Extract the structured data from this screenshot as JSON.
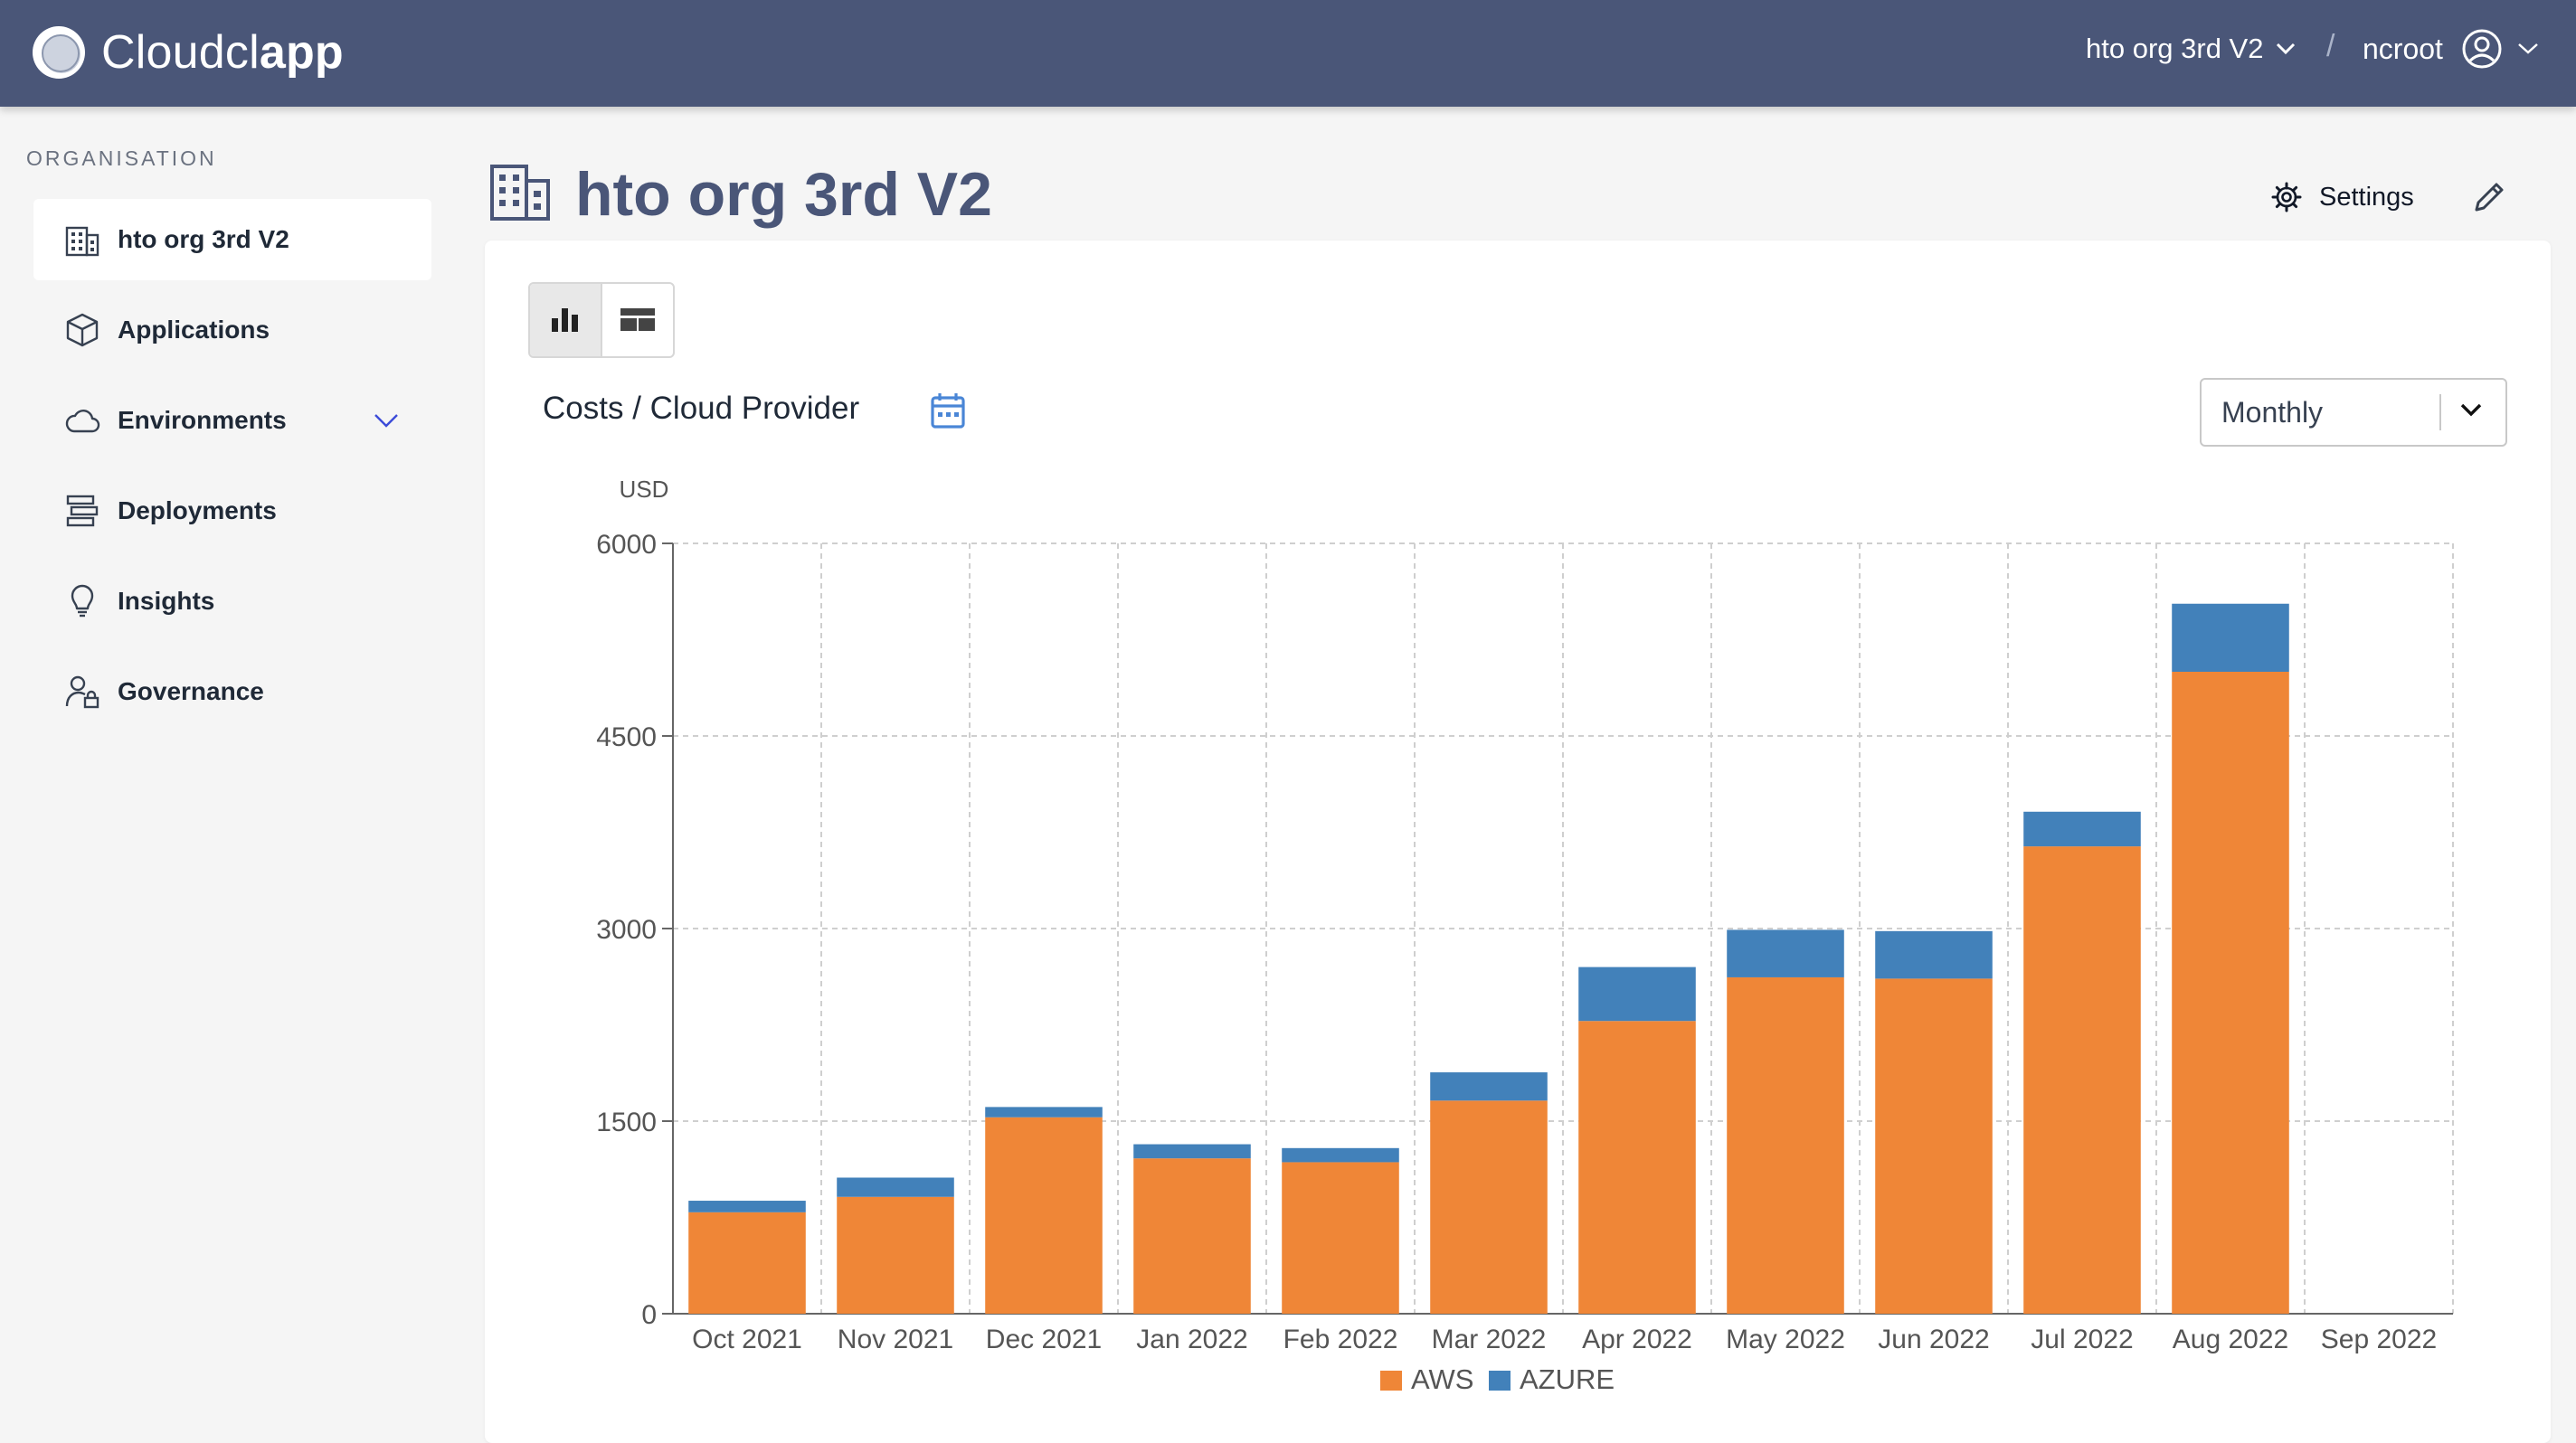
{
  "navbar": {
    "brand_light": "Cloudcl",
    "brand_bold": "app",
    "org_switch_label": "hto org 3rd V2",
    "separator": "/",
    "user_name": "ncroot"
  },
  "sidebar": {
    "title": "ORGANISATION",
    "items": [
      {
        "label": "hto org 3rd V2",
        "icon": "building-icon",
        "active": true
      },
      {
        "label": "Applications",
        "icon": "cube-icon"
      },
      {
        "label": "Environments",
        "icon": "cloud-icon",
        "expandable": true
      },
      {
        "label": "Deployments",
        "icon": "deployments-icon"
      },
      {
        "label": "Insights",
        "icon": "lightbulb-icon"
      },
      {
        "label": "Governance",
        "icon": "user-lock-icon"
      }
    ]
  },
  "header": {
    "title": "hto org 3rd V2",
    "settings_label": "Settings"
  },
  "card": {
    "view_toggle": [
      "bar-chart-view",
      "table-view"
    ],
    "chart_title": "Costs / Cloud Provider",
    "period_select": {
      "value": "Monthly"
    }
  },
  "colors": {
    "navbar": "#4a5678",
    "title": "#4a5678",
    "aws": "#ef8637",
    "azure": "#4281ba",
    "calendar": "#4a86d6"
  },
  "chart_data": {
    "type": "bar",
    "stacked": true,
    "ylabel": "USD",
    "ylim": [
      0,
      6000
    ],
    "yticks": [
      0,
      1500,
      3000,
      4500,
      6000
    ],
    "grid": true,
    "legend": "bottom",
    "categories": [
      "Oct 2021",
      "Nov 2021",
      "Dec 2021",
      "Jan 2022",
      "Feb 2022",
      "Mar 2022",
      "Apr 2022",
      "May 2022",
      "Jun 2022",
      "Jul 2022",
      "Aug 2022",
      "Sep 2022"
    ],
    "series": [
      {
        "name": "AWS",
        "color": "#ef8637",
        "values": [
          790,
          910,
          1530,
          1210,
          1180,
          1660,
          2280,
          2620,
          2610,
          3640,
          5000,
          0
        ]
      },
      {
        "name": "AZURE",
        "color": "#4281ba",
        "values": [
          90,
          150,
          80,
          110,
          110,
          220,
          420,
          370,
          370,
          270,
          530,
          0
        ]
      }
    ]
  }
}
